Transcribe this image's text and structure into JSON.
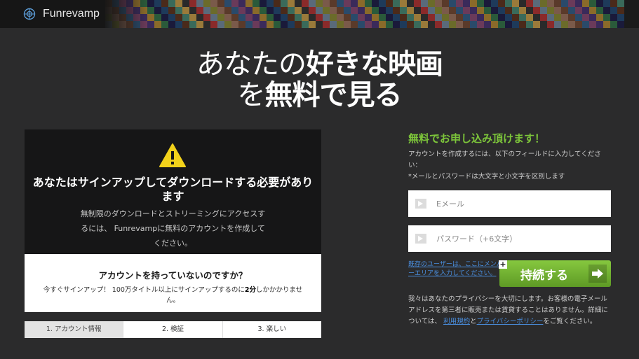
{
  "header": {
    "brand": "Funrevamp",
    "logo_icon": "globe-icon",
    "poster_colors": [
      "#5a3a2a",
      "#1e3a5a",
      "#6b6b2a",
      "#2a5a3a",
      "#8a2a2a",
      "#3a2a5a",
      "#9a7a3a",
      "#2a4a6a",
      "#4a2a1a",
      "#7a5a4a",
      "#1a1a3a",
      "#5a6a7a",
      "#8a6a2a",
      "#2a2a2a",
      "#6a3a5a",
      "#3a6a5a"
    ]
  },
  "hero": {
    "line1_plain": "あなたの",
    "line1_bold": "好きな映画",
    "line2_plain": "を",
    "line2_bold": "無料で見る"
  },
  "notice": {
    "warning_icon": "warning-icon",
    "title": "あなたはサインアップしてダウンロードする必要があります",
    "description": "無制限のダウンロードとストリーミングにアクセスするには、 Funrevampに無料のアカウントを作成してください。"
  },
  "account_box": {
    "question": "アカウントを持っていないのですか？",
    "desc_before": "今すぐサインアップ！ 100万タイトル以上にサインアップするのに",
    "desc_bold": "2分",
    "desc_after": "しかかかりません。"
  },
  "steps": [
    {
      "label": "1. アカウント情報",
      "active": true
    },
    {
      "label": "2. 検証",
      "active": false
    },
    {
      "label": "3. 楽しい",
      "active": false
    }
  ],
  "form": {
    "title": "無料でお申し込み頂けます！",
    "note_line1": "アカウントを作成するには、以下のフィールドに入力してください：",
    "note_line2": "*メールとパスワードは大文字と小文字を区別します",
    "email_placeholder": "Eメール",
    "password_placeholder": "パスワード（+6文字）",
    "member_link": "既存のユーザーは、ここにメンバーエリアを入力してください。",
    "continue_label": "持続する",
    "privacy_text": "我々はあなたのプライバシーを大切にします。お客様の電子メールアドレスを第三者に販売または賃貸することはありません。詳細については、",
    "terms_link": "利用規約",
    "and": "と",
    "privacy_link": "プライバシーポリシー",
    "privacy_end": "をご覧ください。",
    "accent_color": "#7cc43a",
    "link_color": "#4a8fe0"
  }
}
